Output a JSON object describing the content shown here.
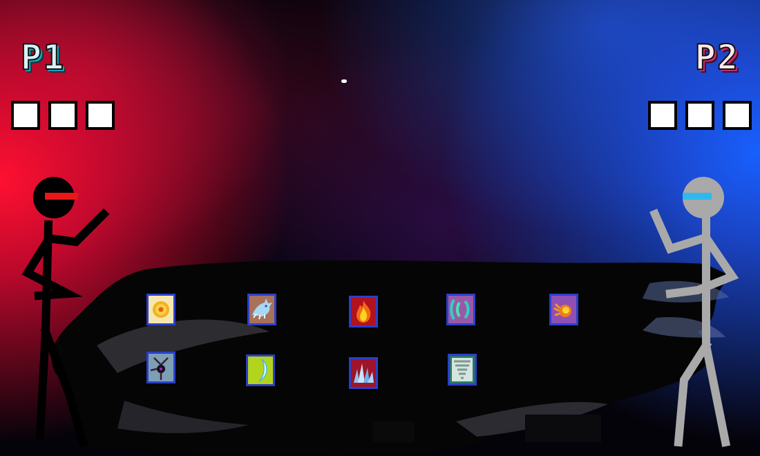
{
  "players": {
    "p1": {
      "label": "P1",
      "lives": 3,
      "visor_color": "#e81818",
      "body_color": "#000000"
    },
    "p2": {
      "label": "P2",
      "lives": 3,
      "visor_color": "#2fb8ee",
      "body_color": "#a9a9a9"
    }
  },
  "colors": {
    "left_glow": "#ff1030",
    "right_glow": "#1860ff",
    "cell_border": "#2b3fc9"
  },
  "power_ups": [
    {
      "icon": "sun-orb-icon",
      "background": "#f6e7b0"
    },
    {
      "icon": "ice-dragon-icon",
      "background": "#a8715a"
    },
    {
      "icon": "fire-icon",
      "background": "#b2121e"
    },
    {
      "icon": "sonic-wave-icon",
      "background": "#9a59a8"
    },
    {
      "icon": "fireball-icon",
      "background": "#8f4fb5"
    },
    {
      "icon": "black-hole-icon",
      "background": "#7c9fb4"
    },
    {
      "icon": "crescent-blade-icon",
      "background": "#b3d41c"
    },
    {
      "icon": "ice-crystal-icon",
      "background": "#9e1428"
    },
    {
      "icon": "tornado-icon",
      "background": "#2a7a6a"
    }
  ]
}
